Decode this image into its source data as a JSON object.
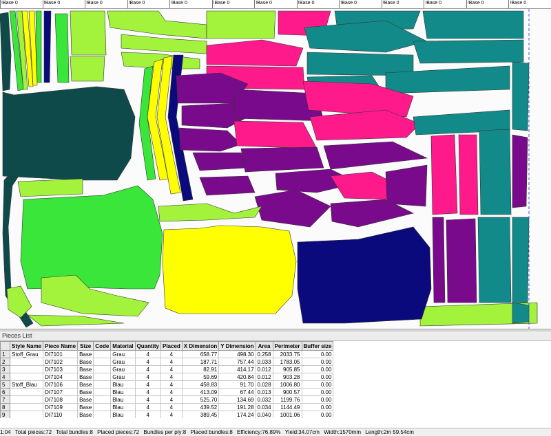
{
  "ruler": {
    "label": "!Base 0",
    "count": 13
  },
  "pieces_panel": {
    "title": "Pieces List"
  },
  "table": {
    "headers": [
      "Style Name",
      "Piece Name",
      "Size",
      "Code",
      "Material",
      "Quantity",
      "Placed",
      "X Dimension",
      "Y Dimension",
      "Area",
      "Perimeter",
      "Buffer size"
    ],
    "rows": [
      {
        "n": "1",
        "style": "Stoff_Grau",
        "piece": "DI7101",
        "size": "Base",
        "code": "",
        "material": "Grau",
        "qty": "4",
        "placed": "4",
        "x": "658.77",
        "y": "498.30",
        "area": "0.258",
        "perim": "2033.75",
        "buffer": "0.00"
      },
      {
        "n": "2",
        "style": "",
        "piece": "DI7102",
        "size": "Base",
        "code": "",
        "material": "Grau",
        "qty": "4",
        "placed": "4",
        "x": "187.71",
        "y": "757.44",
        "area": "0.033",
        "perim": "1783.05",
        "buffer": "0.00"
      },
      {
        "n": "3",
        "style": "",
        "piece": "DI7103",
        "size": "Base",
        "code": "",
        "material": "Grau",
        "qty": "4",
        "placed": "4",
        "x": "82.91",
        "y": "414.17",
        "area": "0.012",
        "perim": "905.85",
        "buffer": "0.00"
      },
      {
        "n": "4",
        "style": "",
        "piece": "DI7104",
        "size": "Base",
        "code": "",
        "material": "Grau",
        "qty": "4",
        "placed": "4",
        "x": "59.69",
        "y": "420.84",
        "area": "0.012",
        "perim": "903.28",
        "buffer": "0.00"
      },
      {
        "n": "5",
        "style": "Stoff_Blau",
        "piece": "DI7106",
        "size": "Base",
        "code": "",
        "material": "Blau",
        "qty": "4",
        "placed": "4",
        "x": "458.83",
        "y": "91.70",
        "area": "0.028",
        "perim": "1006.80",
        "buffer": "0.00"
      },
      {
        "n": "6",
        "style": "",
        "piece": "DI7107",
        "size": "Base",
        "code": "",
        "material": "Blau",
        "qty": "4",
        "placed": "4",
        "x": "413.09",
        "y": "67.44",
        "area": "0.013",
        "perim": "900.57",
        "buffer": "0.00"
      },
      {
        "n": "7",
        "style": "",
        "piece": "DI7108",
        "size": "Base",
        "code": "",
        "material": "Blau",
        "qty": "4",
        "placed": "4",
        "x": "525.70",
        "y": "134.69",
        "area": "0.032",
        "perim": "1199.76",
        "buffer": "0.00"
      },
      {
        "n": "8",
        "style": "",
        "piece": "DI7109",
        "size": "Base",
        "code": "",
        "material": "Blau",
        "qty": "4",
        "placed": "4",
        "x": "439.52",
        "y": "191.28",
        "area": "0.034",
        "perim": "1144.49",
        "buffer": "0.00"
      },
      {
        "n": "9",
        "style": "",
        "piece": "DI7110",
        "size": "Base",
        "code": "",
        "material": "Blau",
        "qty": "4",
        "placed": "4",
        "x": "389.45",
        "y": "174.24",
        "area": "0.040",
        "perim": "1001.06",
        "buffer": "0.00"
      }
    ]
  },
  "status": {
    "zoom": "1:04",
    "total_pieces": "Total pieces:72",
    "total_bundles": "Total bundles:8",
    "placed_pieces": "Placed pieces:72",
    "bundles_per_ply": "Bundles per ply:8",
    "placed_bundles": "Placed bundles:8",
    "efficiency": "Efficiency:76.89%",
    "yield": "Yield:34.07cm",
    "width": "Width:1570mm",
    "length": "Length:2m 59.54cm"
  },
  "colors": {
    "dark_teal": "#0e4a4a",
    "lime": "#39e639",
    "yellow_green": "#a3f23b",
    "yellow": "#ffff00",
    "navy": "#0a0a7d",
    "magenta": "#ff1a8c",
    "purple": "#7a0a8c",
    "teal": "#138a8a"
  }
}
